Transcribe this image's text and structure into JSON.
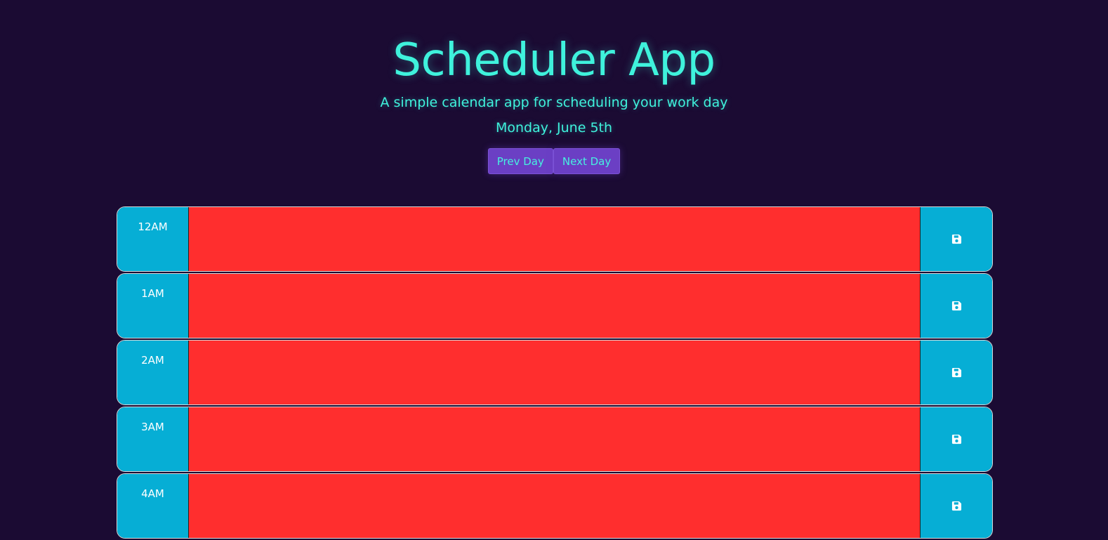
{
  "header": {
    "title": "Scheduler App",
    "subtitle": "A simple calendar app for scheduling your work day",
    "current_date": "Monday, June 5th"
  },
  "nav": {
    "prev_label": "Prev Day",
    "next_label": "Next Day"
  },
  "colors": {
    "background": "#1b0b33",
    "accent_text": "#3ff2dc",
    "button_bg": "#6b3fc4",
    "hour_bg": "#06aed5",
    "past_block": "#ff2e2e"
  },
  "time_blocks": [
    {
      "hour": "12AM",
      "text": "",
      "status": "past",
      "save_icon": "floppy-disk-icon"
    },
    {
      "hour": "1AM",
      "text": "",
      "status": "past",
      "save_icon": "floppy-disk-icon"
    },
    {
      "hour": "2AM",
      "text": "",
      "status": "past",
      "save_icon": "floppy-disk-icon"
    },
    {
      "hour": "3AM",
      "text": "",
      "status": "past",
      "save_icon": "floppy-disk-icon"
    },
    {
      "hour": "4AM",
      "text": "",
      "status": "past",
      "save_icon": "floppy-disk-icon"
    }
  ]
}
